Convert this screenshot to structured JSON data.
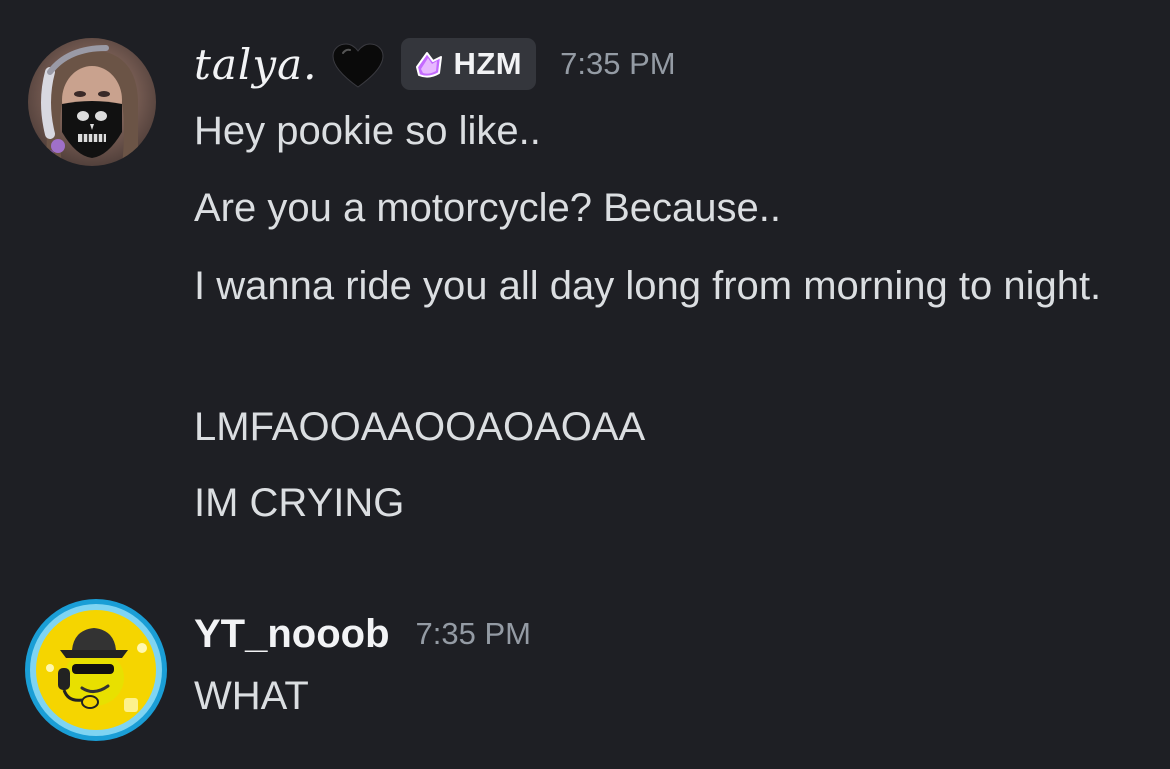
{
  "messages": [
    {
      "author": "talya.",
      "author_decoration": "black-heart",
      "tag": {
        "label": "HZM",
        "icon": "purple-gem-icon"
      },
      "timestamp": "7:35 PM",
      "lines": [
        "Hey pookie so like..",
        "Are you a motorcycle? Because..",
        "I wanna ride you all day long from morning to night.",
        "LMFAOOAAOOAOAOAA",
        "IM CRYING"
      ]
    },
    {
      "author": "YT_nooob",
      "timestamp": "7:35 PM",
      "lines": [
        "WHAT"
      ]
    }
  ],
  "colors": {
    "background": "#1e1f24",
    "text": "#dbdee1",
    "username": "#f2f3f5",
    "timestamp": "#949ba4",
    "tag_background": "#34363c",
    "tag_gem": "#c46bff",
    "avatar_ring": "#25a8e0",
    "avatar_yellow": "#f5d500"
  }
}
